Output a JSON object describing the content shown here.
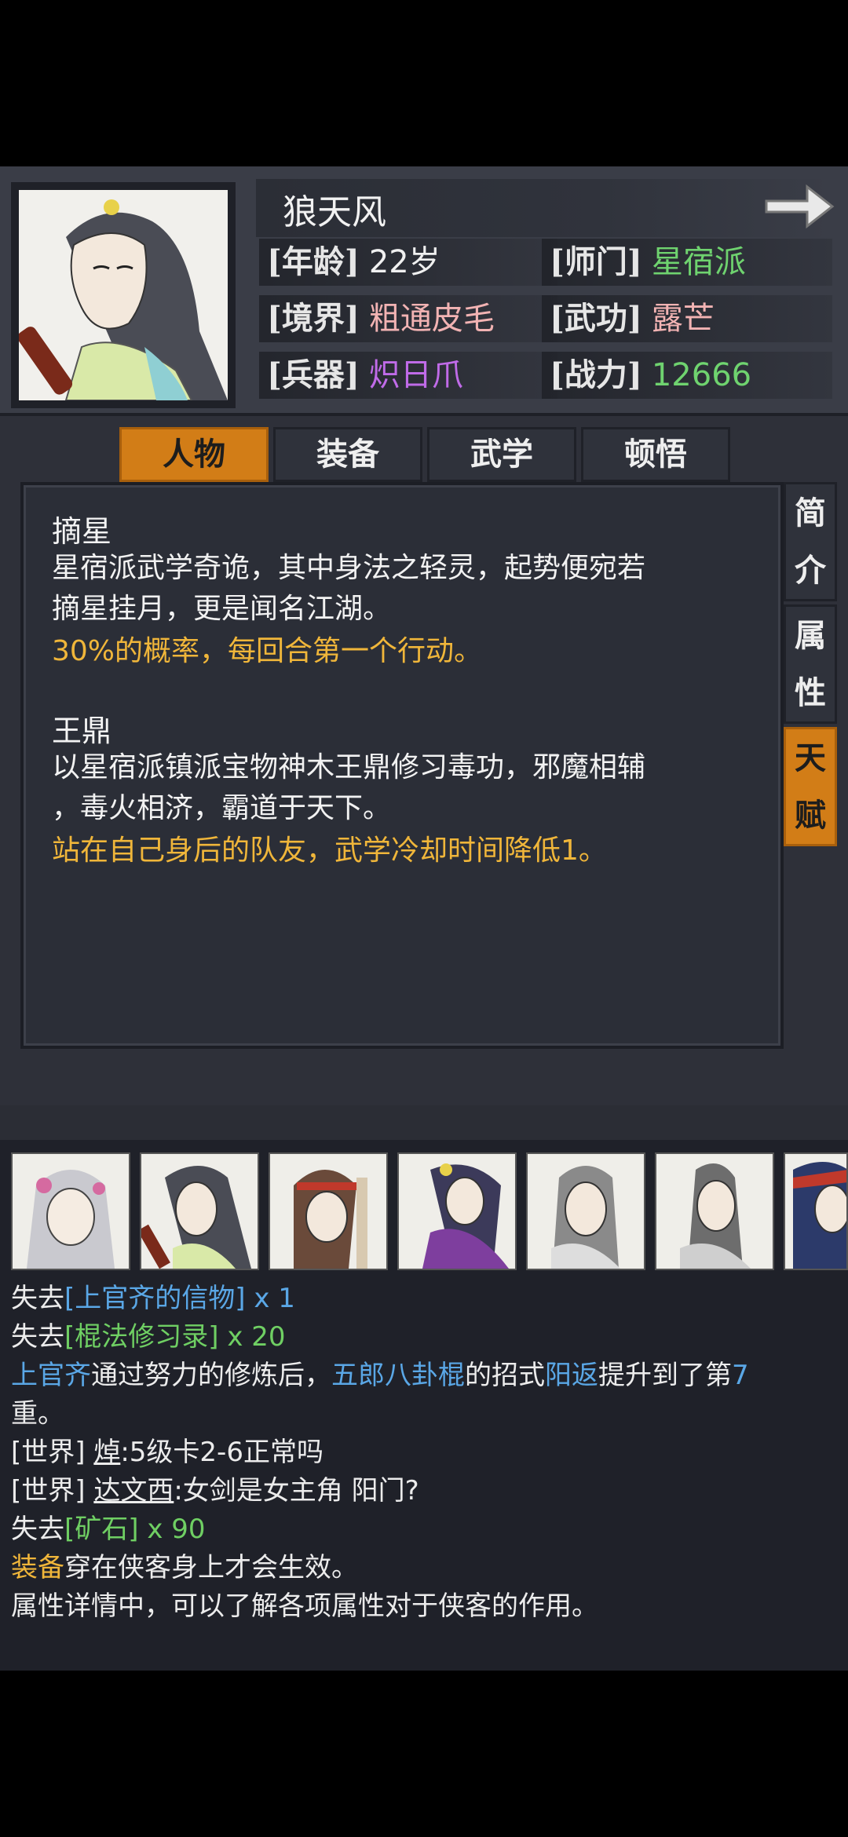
{
  "character": {
    "name": "狼天风",
    "stats": [
      {
        "label": "[年龄]",
        "value": "22岁",
        "color": "#f0f0f0"
      },
      {
        "label": "[师门]",
        "value": "星宿派",
        "color": "#6fd36f"
      },
      {
        "label": "[境界]",
        "value": "粗通皮毛",
        "color": "#f2b3b3"
      },
      {
        "label": "[武功]",
        "value": "露芒",
        "color": "#f2b3b3"
      },
      {
        "label": "[兵器]",
        "value": "炽日爪",
        "color": "#c06be8"
      },
      {
        "label": "[战力]",
        "value": "12666",
        "color": "#6fd36f"
      }
    ]
  },
  "tabs": [
    "人物",
    "装备",
    "武学",
    "顿悟"
  ],
  "side_tabs": [
    {
      "top": "简",
      "bottom": "介"
    },
    {
      "top": "属",
      "bottom": "性"
    },
    {
      "top": "天",
      "bottom": "赋"
    }
  ],
  "talents": [
    {
      "title": "摘星",
      "desc_line1": "星宿派武学奇诡，其中身法之轻灵，起势便宛若",
      "desc_line2": "摘星挂月，更是闻名江湖。",
      "effect": "30%的概率，每回合第一个行动。"
    },
    {
      "title": "王鼎",
      "desc_line1": "以星宿派镇派宝物神木王鼎修习毒功，邪魔相辅",
      "desc_line2": "，毒火相济，霸道于天下。",
      "effect": "站在自己身后的队友，武学冷却时间降低1。"
    }
  ],
  "log": {
    "l1_a": "失去",
    "l1_b": "[上官齐的信物]",
    "l1_c": " x 1",
    "l2_a": "失去",
    "l2_b": "[棍法修习录]",
    "l2_c": " x 20",
    "l3_a": "上官齐",
    "l3_b": "通过努力的修炼后，",
    "l3_c": "五郎八卦棍",
    "l3_d": "的招式",
    "l3_e": "阳返",
    "l3_f": "提升到了第",
    "l3_g": "7",
    "l4": "重。",
    "l5_a": "[世界]",
    "l5_b": "焯",
    "l5_c": ":5级卡2-6正常吗",
    "l6_a": "[世界]",
    "l6_b": "达文西",
    "l6_c": ":女剑是女主角 阳门?",
    "l7_a": "失去",
    "l7_b": "[矿石]",
    "l7_c": " x 90",
    "l8_a": "装备",
    "l8_b": "穿在侠客身上才会生效。",
    "l9": "属性详情中，可以了解各项属性对于侠客的作用。"
  },
  "colors": {
    "accent_orange": "#d27d17",
    "effect_text": "#f0b63a",
    "link_blue": "#5aa7e6",
    "item_green": "#6fcf63"
  }
}
